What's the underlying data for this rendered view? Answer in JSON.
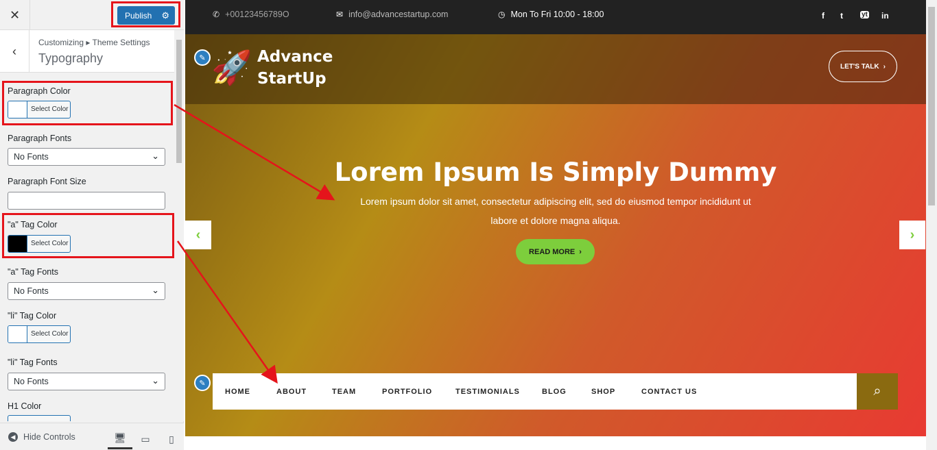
{
  "sidebar": {
    "close_icon": "✕",
    "publish_label": "Publish",
    "breadcrumb": "Customizing ▸ Theme Settings",
    "section_title": "Typography",
    "controls": {
      "paragraph_color": {
        "label": "Paragraph Color",
        "button": "Select Color",
        "color": "#ffffff"
      },
      "paragraph_fonts": {
        "label": "Paragraph Fonts",
        "value": "No Fonts"
      },
      "paragraph_font_size": {
        "label": "Paragraph Font Size",
        "value": ""
      },
      "a_tag_color": {
        "label": "\"a\" Tag Color",
        "button": "Select Color",
        "color": "#000000"
      },
      "a_tag_fonts": {
        "label": "\"a\" Tag Fonts",
        "value": "No Fonts"
      },
      "li_tag_color": {
        "label": "\"li\" Tag Color",
        "button": "Select Color",
        "color": "#ffffff"
      },
      "li_tag_fonts": {
        "label": "\"li\" Tag Fonts",
        "value": "No Fonts"
      },
      "h1_color": {
        "label": "H1 Color"
      }
    },
    "hide_controls": "Hide Controls"
  },
  "preview": {
    "topbar": {
      "phone": "+00123456789O",
      "email": "info@advancestartup.com",
      "hours": "Mon To Fri 10:00 - 18:00",
      "social": [
        "f",
        "t",
        "yt",
        "in"
      ]
    },
    "logo": {
      "line1": "Advance",
      "line2": "StartUp"
    },
    "lets_talk": "LET'S TALK",
    "hero": {
      "title": "Lorem Ipsum Is Simply Dummy",
      "subtitle_line1": "Lorem ipsum dolor sit amet, consectetur adipiscing elit, sed do eiusmod tempor incididunt ut",
      "subtitle_line2": "labore et dolore magna aliqua.",
      "read_more": "READ MORE"
    },
    "nav": [
      "HOME",
      "ABOUT",
      "TEAM",
      "PORTFOLIO",
      "TESTIMONIALS",
      "BLOG",
      "SHOP",
      "CONTACT US"
    ]
  },
  "colors": {
    "annotation_red": "#e5141b",
    "wp_blue": "#2271b1",
    "accent_green": "#7dce3c"
  }
}
